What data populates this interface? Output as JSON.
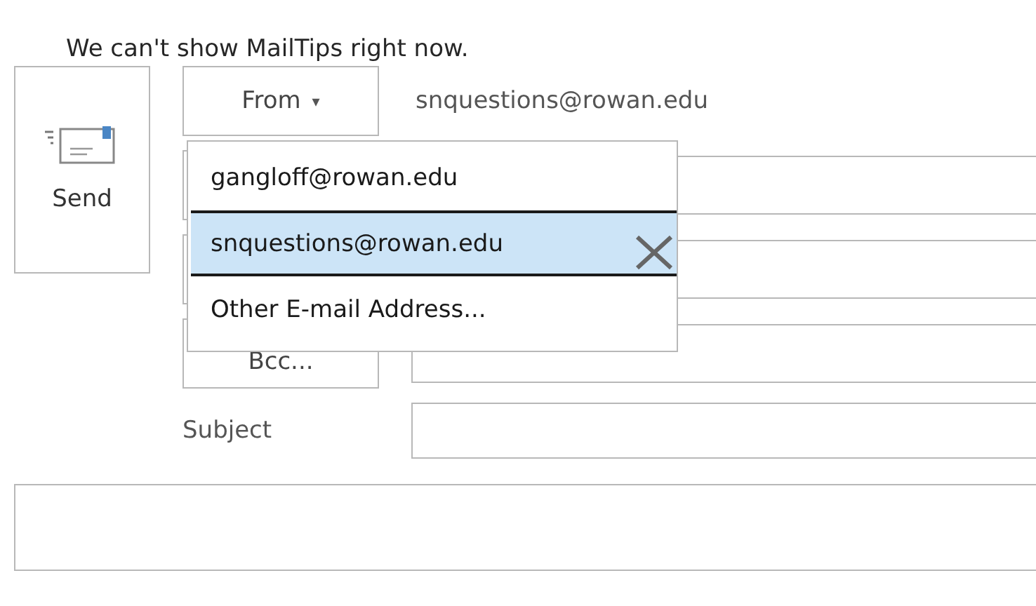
{
  "mailtips": "We can't show MailTips right now.",
  "send_button": {
    "label": "Send"
  },
  "from_button": {
    "label": "From",
    "caret": "▾"
  },
  "from_address": "snquestions@rowan.edu",
  "from_menu": {
    "items": [
      {
        "label": "gangloff@rowan.edu",
        "selected": false
      },
      {
        "label": "snquestions@rowan.edu",
        "selected": true,
        "removable": true
      },
      {
        "label": "Other E-mail Address...",
        "selected": false
      }
    ]
  },
  "bcc_button": {
    "label": "Bcc..."
  },
  "subject": {
    "label": "Subject"
  }
}
